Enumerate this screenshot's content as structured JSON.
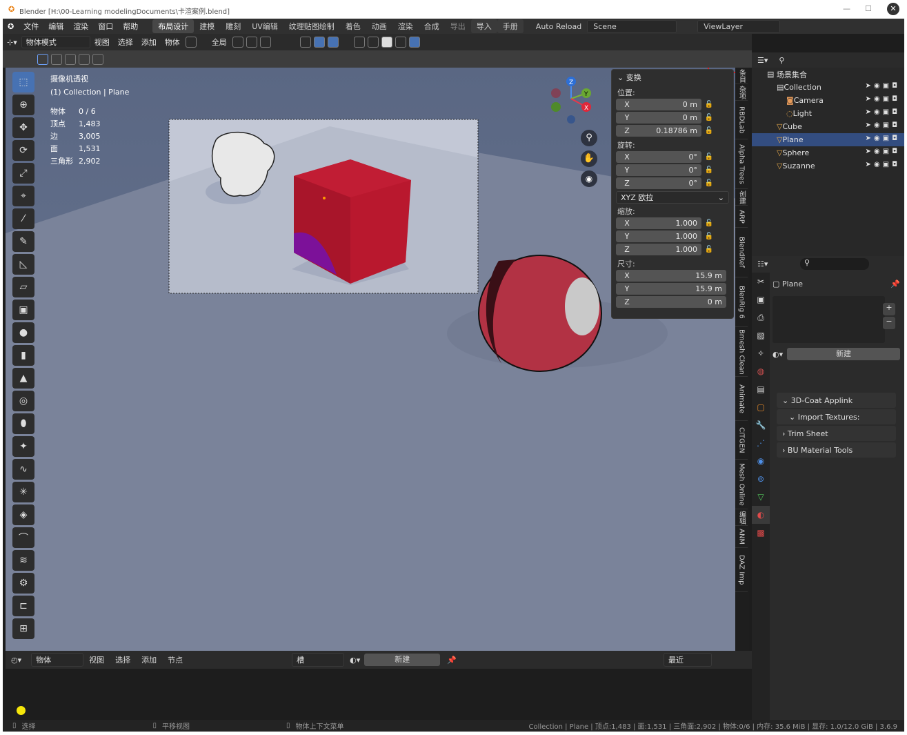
{
  "titlebar": {
    "title": "Blender [H:\\00-Learning modelingDocuments\\卡渲案例.blend]",
    "minimize": "—",
    "maximize": "☐",
    "close": "✕"
  },
  "menu": {
    "items": [
      "文件",
      "编辑",
      "渲染",
      "窗口",
      "帮助"
    ],
    "workspaces": [
      "布局设计",
      "建模",
      "雕刻",
      "UV编辑",
      "纹理贴图绘制",
      "着色",
      "动画",
      "渲染",
      "合成"
    ],
    "export": "导出",
    "import": "导入",
    "manual": "手册",
    "auto_reload": "Auto Reload",
    "scene": "Scene",
    "view_layer": "ViewLayer"
  },
  "viewport_header": {
    "mode": "物体模式",
    "menus": [
      "视图",
      "选择",
      "添加",
      "物体"
    ],
    "pivot": "全局"
  },
  "overlay": {
    "view_name": "摄像机透视",
    "collection_label": "(1) Collection | Plane",
    "stats": [
      {
        "label": "物体",
        "value": "0 / 6"
      },
      {
        "label": "顶点",
        "value": "1,483"
      },
      {
        "label": "边",
        "value": "3,005"
      },
      {
        "label": "面",
        "value": "1,531"
      },
      {
        "label": "三角形",
        "value": "2,902"
      }
    ]
  },
  "gizmo": {
    "z": "Z",
    "y": "Y",
    "x": "X"
  },
  "transform": {
    "title": "变换",
    "location_label": "位置:",
    "location": [
      {
        "axis": "X",
        "value": "0 m"
      },
      {
        "axis": "Y",
        "value": "0 m"
      },
      {
        "axis": "Z",
        "value": "0.18786 m"
      }
    ],
    "rotation_label": "旋转:",
    "rotation": [
      {
        "axis": "X",
        "value": "0°"
      },
      {
        "axis": "Y",
        "value": "0°"
      },
      {
        "axis": "Z",
        "value": "0°"
      }
    ],
    "rotation_mode": "XYZ 欧拉",
    "scale_label": "缩放:",
    "scale": [
      {
        "axis": "X",
        "value": "1.000"
      },
      {
        "axis": "Y",
        "value": "1.000"
      },
      {
        "axis": "Z",
        "value": "1.000"
      }
    ],
    "dimensions_label": "尺寸:",
    "dimensions": [
      {
        "axis": "X",
        "value": "15.9 m"
      },
      {
        "axis": "Y",
        "value": "15.9 m"
      },
      {
        "axis": "Z",
        "value": "0 m"
      }
    ]
  },
  "side_tabs": [
    "条目",
    "杂项",
    "RBDLab",
    "Alpha Trees",
    "创建",
    "ARP",
    "BlendRef",
    "BlenRig 6",
    "Bmesh Clean",
    "Animate",
    "CITGEN",
    "Mesh Online",
    "编辑",
    "ANM",
    "DAZ Imp"
  ],
  "outliner": {
    "root": "场景集合",
    "items": [
      {
        "name": "Collection",
        "icon": "collection-icon",
        "indent": 1
      },
      {
        "name": "Camera",
        "icon": "camera-icon",
        "indent": 2
      },
      {
        "name": "Light",
        "icon": "light-icon",
        "indent": 2
      },
      {
        "name": "Cube",
        "icon": "mesh-icon",
        "indent": 1
      },
      {
        "name": "Plane",
        "icon": "mesh-icon",
        "indent": 1
      },
      {
        "name": "Sphere",
        "icon": "mesh-icon",
        "indent": 1
      },
      {
        "name": "Suzanne",
        "icon": "mesh-icon",
        "indent": 1
      }
    ]
  },
  "properties": {
    "object_name": "Plane",
    "new_label": "新建",
    "panels": [
      "3D-Coat Applink",
      "Import Textures:",
      "Trim Sheet",
      "BU Material Tools"
    ]
  },
  "bottom_editor": {
    "mode": "物体",
    "menus": [
      "视图",
      "选择",
      "添加",
      "节点"
    ],
    "slot": "槽",
    "new_label": "新建",
    "recent": "最近"
  },
  "status": {
    "select": "选择",
    "pan": "平移视图",
    "context": "物体上下文菜单",
    "info": "Collection | Plane | 顶点:1,483 | 面:1,531 | 三角面:2,902 | 物体:0/6 | 内存: 35.6 MiB | 显存: 1.0/12.0 GiB | 3.6.9"
  }
}
